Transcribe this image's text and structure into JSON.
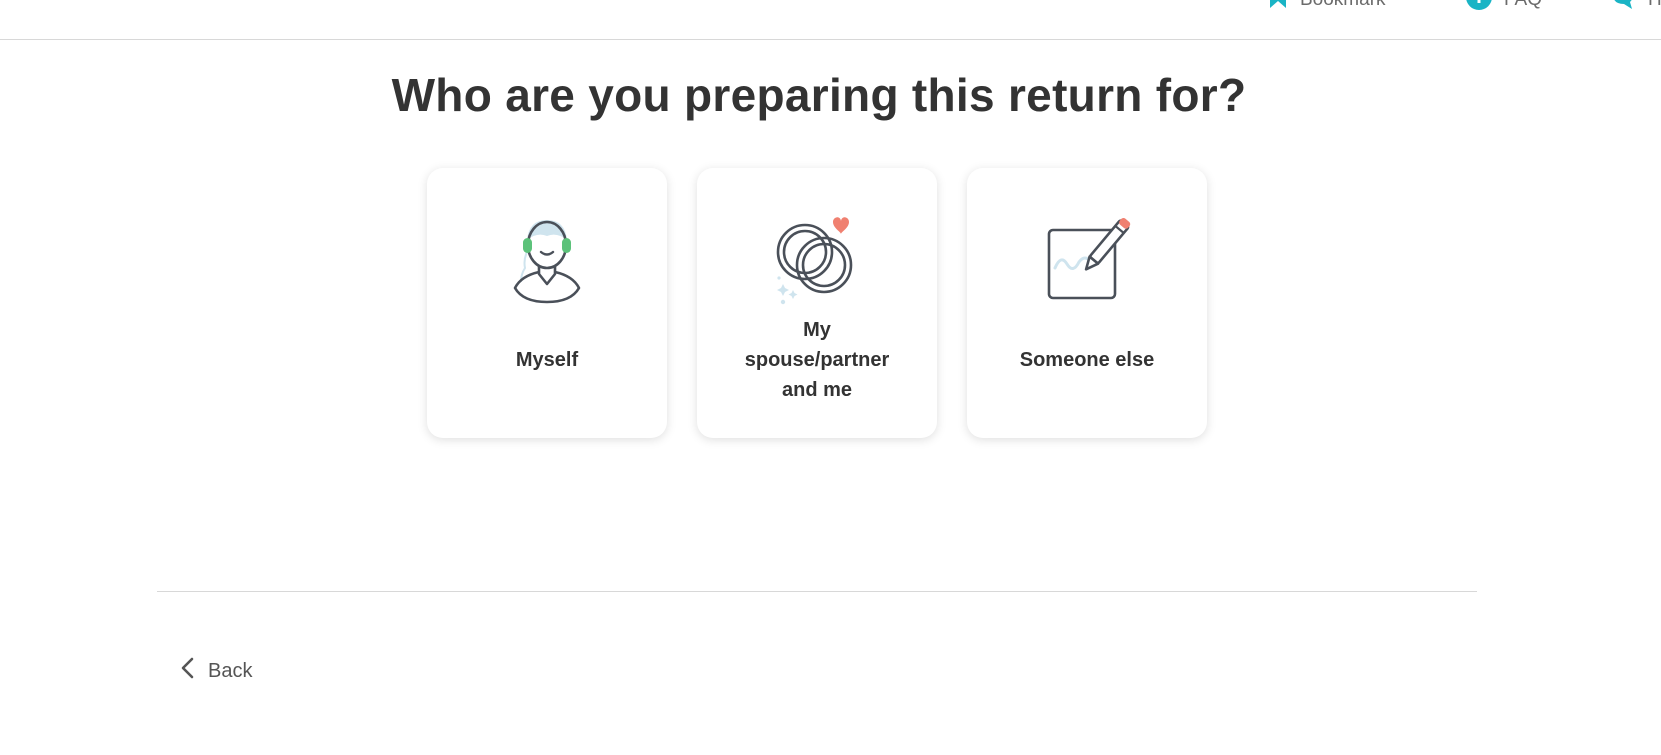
{
  "header": {
    "bookmark_label": "Bookmark",
    "faq_label": "FAQ",
    "help_label": "Help"
  },
  "page": {
    "title": "Who are you preparing this return for?"
  },
  "options": [
    {
      "label": "Myself",
      "icon": "person-headset-icon"
    },
    {
      "label_lines": [
        "My",
        "spouse/partner",
        "and me"
      ],
      "icon": "wedding-rings-icon"
    },
    {
      "label": "Someone else",
      "icon": "signature-pen-icon"
    }
  ],
  "footer": {
    "back_label": "Back"
  },
  "colors": {
    "accent": "#1ab4c5",
    "heart": "#f08070",
    "headset": "#5cc27a",
    "line_art": "#4a5059",
    "light_blue": "#cfe4ee"
  }
}
